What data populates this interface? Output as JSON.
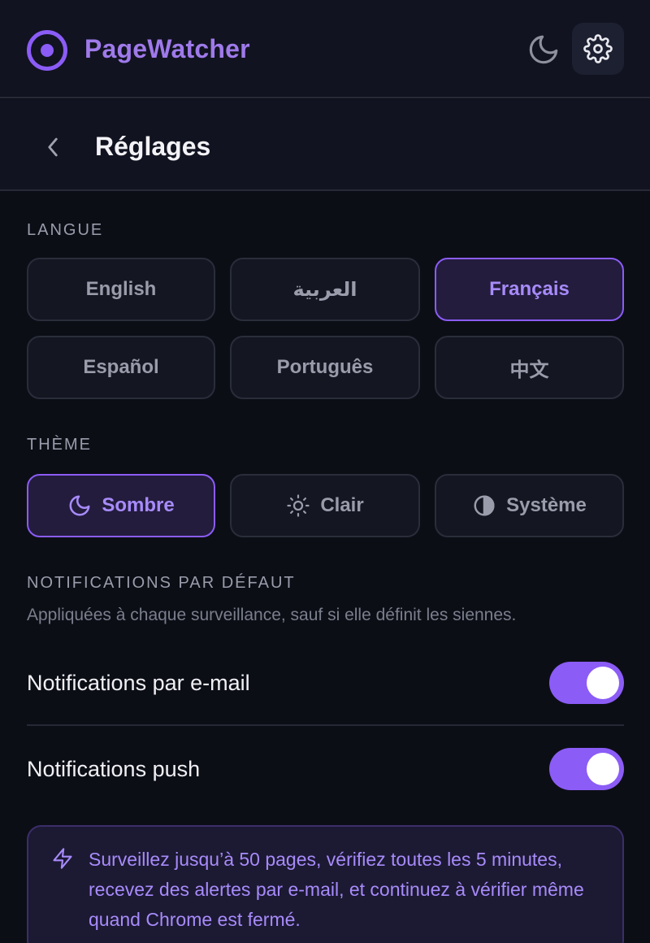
{
  "app": {
    "title": "PageWatcher"
  },
  "header": {
    "moon_icon": "moon-icon",
    "settings_icon": "gear-icon"
  },
  "subheader": {
    "back_icon": "chevron-left-icon",
    "title": "Réglages"
  },
  "language": {
    "label": "LANGUE",
    "options": [
      "English",
      "العربية",
      "Français",
      "Español",
      "Português",
      "中文"
    ],
    "selected": "Français"
  },
  "theme": {
    "label": "THÈME",
    "options": [
      {
        "label": "Sombre",
        "icon": "moon-icon"
      },
      {
        "label": "Clair",
        "icon": "sun-icon"
      },
      {
        "label": "Système",
        "icon": "half-circle-icon"
      }
    ],
    "selected": "Sombre"
  },
  "notifications": {
    "label": "NOTIFICATIONS PAR DÉFAUT",
    "description": "Appliquées à chaque surveillance, sauf si elle définit les siennes.",
    "email": {
      "label": "Notifications par e-mail",
      "enabled": true
    },
    "push": {
      "label": "Notifications push",
      "enabled": true
    }
  },
  "promo": {
    "icon": "bolt-icon",
    "text": "Surveillez jusqu’à 50 pages, vérifiez toutes les 5 minutes, recevez des alertes par e-mail, et continuez à vérifier même quand Chrome est fermé."
  },
  "colors": {
    "accent": "#8b5cf6",
    "accent_text": "#a78bfa",
    "background": "#0c0e16",
    "panel": "#111320"
  }
}
